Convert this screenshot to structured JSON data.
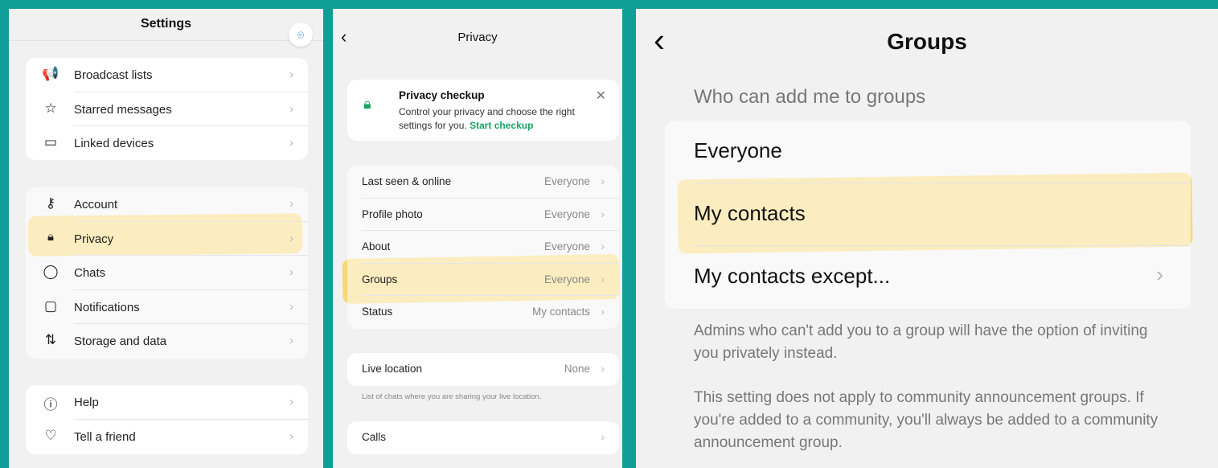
{
  "settings": {
    "title": "Settings",
    "group1": [
      {
        "icon": "megaphone-icon",
        "glyph": "📢",
        "label": "Broadcast lists"
      },
      {
        "icon": "star-icon",
        "glyph": "☆",
        "label": "Starred messages"
      },
      {
        "icon": "laptop-icon",
        "glyph": "▭",
        "label": "Linked devices"
      }
    ],
    "group2": [
      {
        "icon": "key-icon",
        "glyph": "⚷",
        "label": "Account"
      },
      {
        "icon": "lock-icon",
        "glyph": "🔒",
        "label": "Privacy"
      },
      {
        "icon": "chat-bubble-icon",
        "glyph": "◯",
        "label": "Chats"
      },
      {
        "icon": "notification-icon",
        "glyph": "▢",
        "label": "Notifications"
      },
      {
        "icon": "arrows-updown-icon",
        "glyph": "⇅",
        "label": "Storage and data"
      }
    ],
    "group3": [
      {
        "icon": "info-icon",
        "glyph": "ⓘ",
        "label": "Help"
      },
      {
        "icon": "heart-icon",
        "glyph": "♡",
        "label": "Tell a friend"
      }
    ]
  },
  "privacy": {
    "title": "Privacy",
    "checkup_title": "Privacy checkup",
    "checkup_desc": "Control your privacy and choose the right settings for you.",
    "checkup_link": "Start checkup",
    "rows": [
      {
        "label": "Last seen & online",
        "value": "Everyone"
      },
      {
        "label": "Profile photo",
        "value": "Everyone"
      },
      {
        "label": "About",
        "value": "Everyone"
      },
      {
        "label": "Groups",
        "value": "Everyone"
      },
      {
        "label": "Status",
        "value": "My contacts"
      }
    ],
    "live_location": {
      "label": "Live location",
      "value": "None"
    },
    "live_note": "List of chats where you are sharing your live location.",
    "calls": "Calls"
  },
  "groups": {
    "title": "Groups",
    "section": "Who can add me to groups",
    "options": [
      "Everyone",
      "My contacts",
      "My contacts except..."
    ],
    "note1": "Admins who can't add you to a group will have the option of inviting you privately instead.",
    "note2": "This setting does not apply to community announcement groups. If you're added to a community, you'll always be added to a community announcement group."
  },
  "colors": {
    "highlight": "#f8d45c",
    "accent": "#19a463",
    "border": "#0e9e96"
  }
}
